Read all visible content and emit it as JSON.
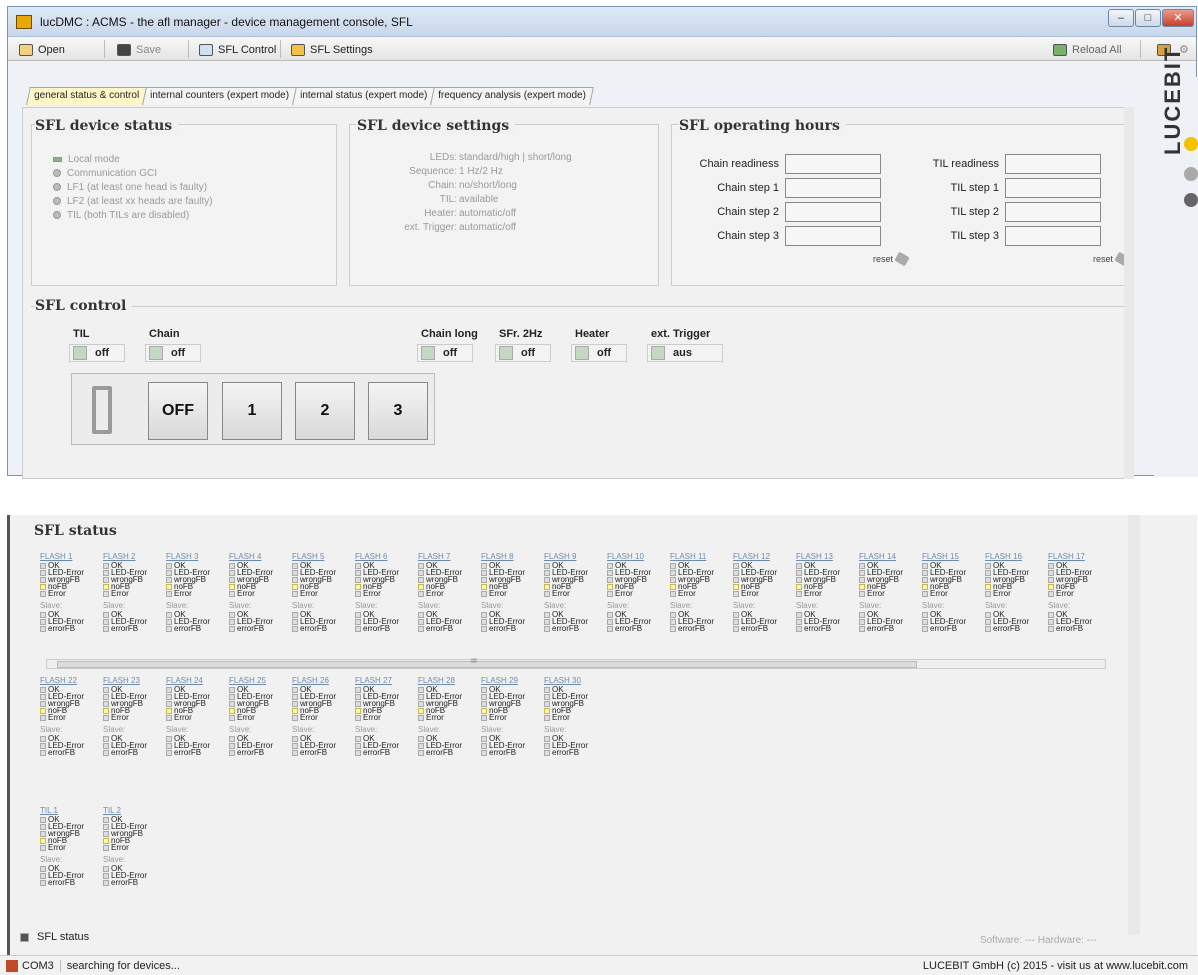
{
  "window": {
    "title": "lucDMC : ACMS - the afl manager - device management console, SFL"
  },
  "toolbar": {
    "open": "Open",
    "save": "Save",
    "sfl_control": "SFL Control",
    "sfl_settings": "SFL Settings",
    "reload": "Reload All"
  },
  "tabs": [
    "general status & control",
    "internal counters  (expert mode)",
    "internal status (expert mode)",
    "frequency analysis (expert mode)"
  ],
  "device_status": {
    "title": "SFL device status",
    "items": [
      "Local mode",
      "Communication GCI",
      "LF1 (at least one head is faulty)",
      "LF2 (at least xx heads are faulty)",
      "TIL (both TILs are disabled)"
    ]
  },
  "device_settings": {
    "title": "SFL device settings",
    "rows": [
      [
        "LEDs:",
        "standard/high | short/long"
      ],
      [
        "Sequence:",
        "1 Hz/2 Hz"
      ],
      [
        "Chain:",
        "no/short/long"
      ],
      [
        "TIL:",
        "available"
      ],
      [
        "Heater:",
        "automatic/off"
      ],
      [
        "ext. Trigger:",
        "automatic/off"
      ]
    ]
  },
  "hours": {
    "title": "SFL operating hours",
    "left": [
      "Chain readiness",
      "Chain step 1",
      "Chain step 2",
      "Chain step 3"
    ],
    "right": [
      "TIL readiness",
      "TIL step 1",
      "TIL step 2",
      "TIL step 3"
    ],
    "reset": "reset"
  },
  "control": {
    "title": "SFL control",
    "toggles": [
      {
        "label": "TIL",
        "value": "off"
      },
      {
        "label": "Chain",
        "value": "off"
      },
      {
        "label": "Chain long",
        "value": "off"
      },
      {
        "label": "SFr. 2Hz",
        "value": "off"
      },
      {
        "label": "Heater",
        "value": "off"
      },
      {
        "label": "ext. Trigger",
        "value": "aus"
      }
    ],
    "buttons": [
      "OFF",
      "1",
      "2",
      "3"
    ]
  },
  "brand": "LUCEBIT",
  "sfl_status": {
    "title": "SFL status",
    "row1": [
      "FLASH 1",
      "FLASH 2",
      "FLASH 3",
      "FLASH 4",
      "FLASH 5",
      "FLASH 6",
      "FLASH 7",
      "FLASH 8",
      "FLASH 9",
      "FLASH 10",
      "FLASH 11",
      "FLASH 12",
      "FLASH 13",
      "FLASH 14",
      "FLASH 15",
      "FLASH 16",
      "FLASH 17"
    ],
    "row2": [
      "FLASH 22",
      "FLASH 23",
      "FLASH 24",
      "FLASH 25",
      "FLASH 26",
      "FLASH 27",
      "FLASH 28",
      "FLASH 29",
      "FLASH 30"
    ],
    "row3": [
      "TIL 1",
      "TIL 2"
    ],
    "master": [
      "OK",
      "LED-Error",
      "wrongFB",
      "noFB",
      "Error"
    ],
    "slave_label": "Slave:",
    "slave": [
      "OK",
      "LED-Error",
      "errorFB"
    ],
    "scroll_mark": "III"
  },
  "bottom": {
    "tab": "SFL status",
    "software": "Software:  ---  Hardware:  ---"
  },
  "statusbar": {
    "port": "COM3",
    "msg": "searching for devices...",
    "copy": "LUCEBIT GmbH (c) 2015 - visit us at www.lucebit.com"
  },
  "colors": {
    "accent": "#e9a800",
    "led_green": "#88b48a"
  }
}
